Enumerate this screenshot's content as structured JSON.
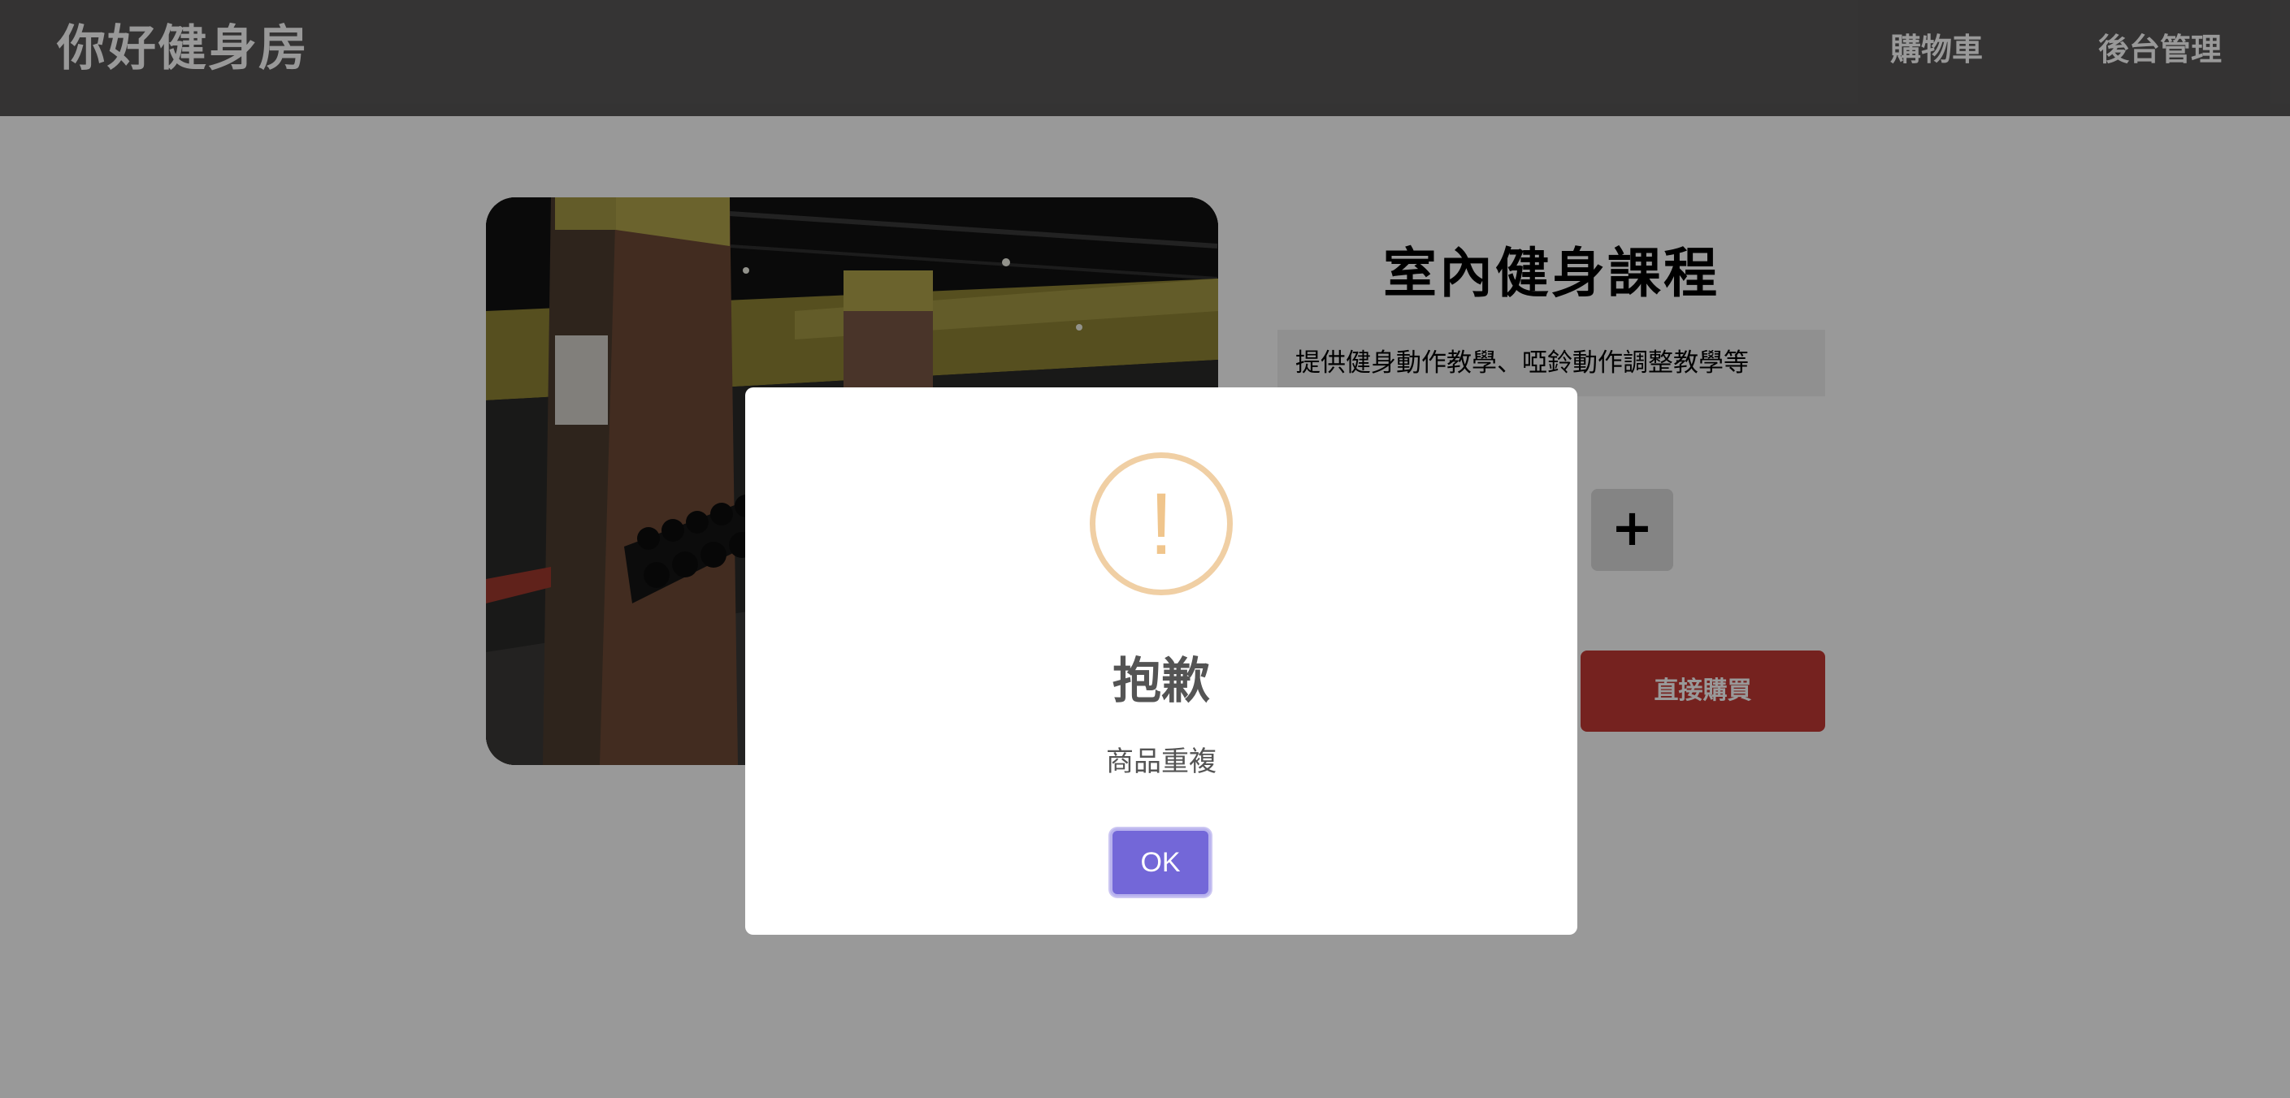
{
  "header": {
    "brand": "你好健身房",
    "nav": {
      "cart": "購物車",
      "admin": "後台管理"
    }
  },
  "product": {
    "title": "室內健身課程",
    "description": "提供健身動作教學、啞鈴動作調整教學等",
    "qty_plus": "+",
    "buy_now": "直接購買"
  },
  "dialog": {
    "icon": "warning-icon",
    "icon_glyph": "!",
    "title": "抱歉",
    "text": "商品重複",
    "confirm": "OK"
  },
  "colors": {
    "navbar": "#585656",
    "overlay": "rgba(0,0,0,0.4)",
    "buy_now": "#c43a35",
    "ok_button": "#7367d8",
    "warning": "#f0c58c"
  }
}
